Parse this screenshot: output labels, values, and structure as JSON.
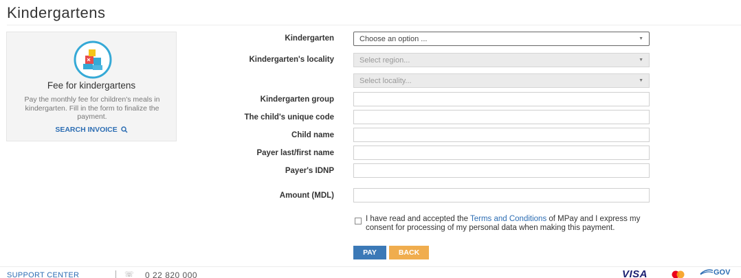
{
  "page": {
    "title": "Kindergartens"
  },
  "card": {
    "title": "Fee for kindergartens",
    "description": "Pay the monthly fee for children's meals in kindergarten. Fill in the form to finalize the payment.",
    "search_label": "SEARCH INVOICE",
    "logo_icon": "kindergarten-blocks-icon"
  },
  "form": {
    "kindergarten": {
      "label": "Kindergarten",
      "value": "Choose an option ..."
    },
    "locality": {
      "label": "Kindergarten's locality",
      "region_placeholder": "Select region...",
      "locality_placeholder": "Select locality..."
    },
    "group": {
      "label": "Kindergarten group",
      "value": ""
    },
    "unique_code": {
      "label": "The child's unique code",
      "value": ""
    },
    "child_name": {
      "label": "Child name",
      "value": ""
    },
    "payer_name": {
      "label": "Payer last/first name",
      "value": ""
    },
    "payer_idnp": {
      "label": "Payer's IDNP",
      "value": ""
    },
    "amount": {
      "label": "Amount (MDL)",
      "value": ""
    }
  },
  "consent": {
    "checked": false,
    "text_before": "I have read and accepted the ",
    "link": "Terms and Conditions",
    "text_after": " of MPay and I express my consent for processing of my personal data when making this payment."
  },
  "buttons": {
    "pay": "PAY",
    "back": "BACK"
  },
  "footer": {
    "support": "SUPPORT CENTER",
    "phone": "0 22 820 000",
    "visa": "VISA",
    "mastercard_icon": "mastercard-icon",
    "gov": "GOV"
  },
  "colors": {
    "link": "#2c6db3",
    "pay_button": "#3b79b7",
    "back_button": "#f0ad4e",
    "card_background": "#f4f4f4"
  }
}
